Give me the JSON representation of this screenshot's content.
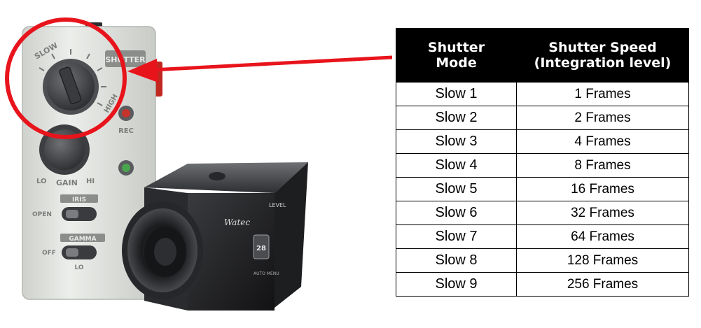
{
  "table": {
    "headers": {
      "mode_line1": "Shutter",
      "mode_line2": "Mode",
      "speed_line1": "Shutter Speed",
      "speed_line2": "(Integration level)"
    },
    "rows": [
      {
        "mode": "Slow 1",
        "speed": "1 Frames"
      },
      {
        "mode": "Slow 2",
        "speed": "2 Frames"
      },
      {
        "mode": "Slow 3",
        "speed": "4 Frames"
      },
      {
        "mode": "Slow 4",
        "speed": "8 Frames"
      },
      {
        "mode": "Slow 5",
        "speed": "16 Frames"
      },
      {
        "mode": "Slow 6",
        "speed": "32 Frames"
      },
      {
        "mode": "Slow 7",
        "speed": "64 Frames"
      },
      {
        "mode": "Slow 8",
        "speed": "128 Frames"
      },
      {
        "mode": "Slow 9",
        "speed": "256 Frames"
      }
    ]
  },
  "panel": {
    "dial_ring_label": "SLOW",
    "dial_side_label": "HIGH",
    "shutter_label": "SHUTTER",
    "rec_label": "REC",
    "gain_label": "GAIN",
    "lo_label": "LO",
    "hi_label": "HI",
    "iris_label": "IRIS",
    "open_label": "OPEN",
    "gamma_label": "GAMMA",
    "off_label": "OFF"
  },
  "camera": {
    "brand": "Watec",
    "level_label": "LEVEL",
    "badge_text": "28",
    "button_label": "AUTO MENU"
  },
  "colors": {
    "highlight": "#e8141c",
    "table_header_bg": "#000000",
    "panel_bg": "#e4e5e2"
  }
}
